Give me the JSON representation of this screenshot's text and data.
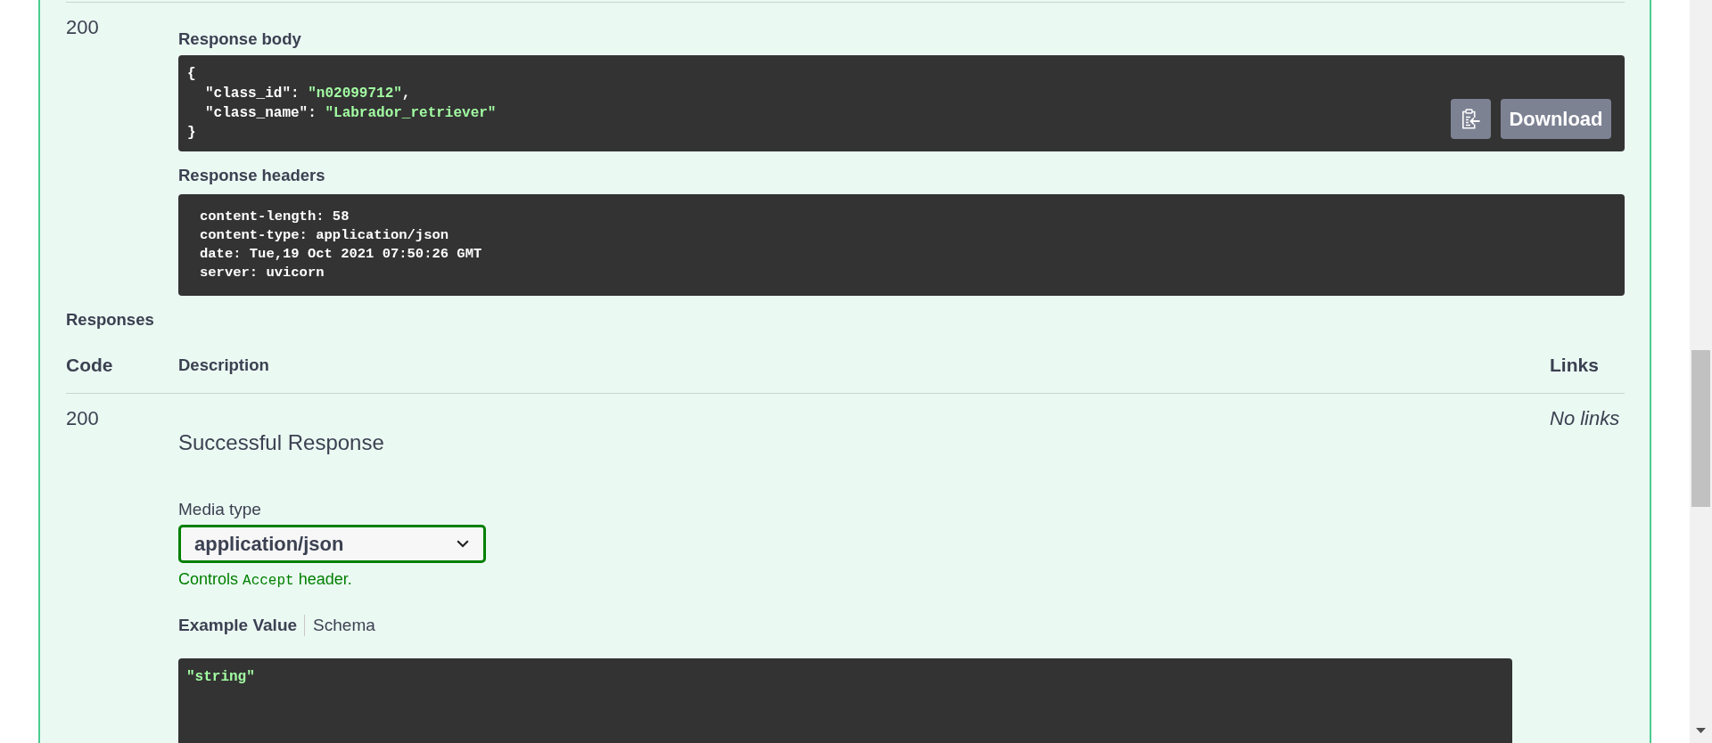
{
  "response": {
    "code": "200",
    "body": {
      "label": "Response body",
      "lines": [
        {
          "tokens": [
            {
              "kind": "punct",
              "text": "{"
            }
          ],
          "children": [
            {
              "tokens": [
                {
                  "kind": "key",
                  "text": "\"class_id\""
                },
                {
                  "kind": "punct",
                  "text": ": "
                },
                {
                  "kind": "string",
                  "text": "\"n02099712\""
                },
                {
                  "kind": "punct",
                  "text": ","
                }
              ]
            },
            {
              "tokens": [
                {
                  "kind": "key",
                  "text": "\"class_name\""
                },
                {
                  "kind": "punct",
                  "text": ": "
                },
                {
                  "kind": "string",
                  "text": "\"Labrador_retriever\""
                }
              ]
            }
          ]
        },
        {
          "tokens": [
            {
              "kind": "punct",
              "text": "}"
            }
          ]
        }
      ],
      "download": "Download"
    },
    "headers": {
      "label": "Response headers",
      "lines": [
        "content-length: 58",
        "content-type: application/json",
        "date: Tue,19 Oct 2021 07:50:26 GMT",
        "server: uvicorn"
      ]
    }
  },
  "responses": {
    "title": "Responses",
    "columns": [
      "Code",
      "Description",
      "Links"
    ],
    "rows": [
      {
        "code": "200",
        "description": "Successful Response",
        "links": "No links",
        "media_type": {
          "label": "Media type",
          "value": "application/json",
          "hint": [
            {
              "kind": "text",
              "text": "Controls "
            },
            {
              "kind": "code",
              "text": "Accept"
            },
            {
              "kind": "text",
              "text": " header."
            }
          ]
        },
        "example_tabs": [
          {
            "label": "Example Value",
            "selected": true
          },
          {
            "label": "Schema",
            "selected": false
          }
        ],
        "example_lines": [
          {
            "tokens": [
              {
                "kind": "string",
                "text": "\"string\""
              }
            ]
          }
        ]
      }
    ]
  }
}
